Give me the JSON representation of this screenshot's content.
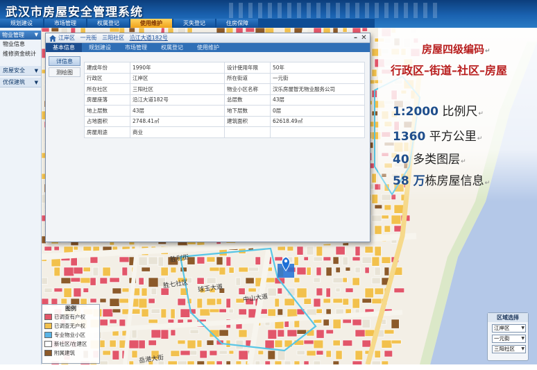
{
  "app": {
    "title": "武汉市房屋安全管理系统"
  },
  "top_nav": {
    "tabs": [
      {
        "label": "规划建设",
        "active": false
      },
      {
        "label": "市场管理",
        "active": false
      },
      {
        "label": "权属登记",
        "active": false
      },
      {
        "label": "使用维护",
        "active": true
      },
      {
        "label": "灭失登记",
        "active": false
      },
      {
        "label": "住房保障",
        "active": false
      }
    ]
  },
  "sidebar": {
    "group1": {
      "label": "物业管理"
    },
    "items": [
      "物业信息",
      "维修资金统计"
    ],
    "group2": {
      "label": "房屋安全"
    },
    "group3": {
      "label": "优保建筑"
    }
  },
  "popup": {
    "breadcrumb": [
      "江岸区",
      "一元街",
      "三阳社区",
      "沿江大道182号"
    ],
    "tabs": [
      "基本信息",
      "规划建设",
      "市场管理",
      "权属登记",
      "使用维护"
    ],
    "active_tab": 0,
    "subnav": [
      "详信息",
      "测绘图"
    ],
    "table": [
      {
        "l1": "建成年份",
        "v1": "1990年",
        "l2": "设计使用年限",
        "v2": "50年"
      },
      {
        "l1": "行政区",
        "v1": "江岸区",
        "l2": "所在街道",
        "v2": "一元街"
      },
      {
        "l1": "所在社区",
        "v1": "三阳社区",
        "l2": "物业小区名称",
        "v2": "汉乐房屋智无物业服务公司"
      },
      {
        "l1": "房屋座落",
        "v1": "沿江大道182号",
        "l2": "总层数",
        "v2": "43层"
      },
      {
        "l1": "地上层数",
        "v1": "43层",
        "l2": "地下层数",
        "v2": "0层"
      },
      {
        "l1": "占地面积",
        "v1": "2748.41㎡",
        "l2": "建筑面积",
        "v2": "62618.49㎡"
      },
      {
        "l1": "房屋用途",
        "v1": "商业",
        "l2": "",
        "v2": ""
      }
    ]
  },
  "map": {
    "labels": {
      "street1": "胜利街",
      "community": "胜七社区",
      "road1": "岳港大街",
      "area1": "球玉大道",
      "area2": "中山大道"
    },
    "colors": {
      "building_red": "#e2566a",
      "building_yellow": "#f2c14d",
      "building_brown": "#8c5a2a",
      "road": "#f7f5ee",
      "river": "#b4c8e8",
      "marker": "#1d6fd6"
    }
  },
  "legend": {
    "title": "图例",
    "items": [
      {
        "label": "已调查有户权",
        "color": "#e2566a"
      },
      {
        "label": "已调查无户权",
        "color": "#f2c14d"
      },
      {
        "label": "专业物业小区",
        "color": "#5ab4e6"
      },
      {
        "label": "新社区/在建区",
        "color": "#ffffff"
      },
      {
        "label": "附属建筑",
        "color": "#8c5a2a"
      }
    ]
  },
  "region": {
    "title": "区域选择",
    "district": "江岸区",
    "street": "一元街",
    "community": "三阳社区"
  },
  "info": {
    "headline1": "房屋四级编码",
    "headline2": "行政区–街道–社区–房屋",
    "stats": [
      {
        "value": "1:2000",
        "text": "比例尺"
      },
      {
        "value": "1360",
        "text": "平方公里"
      },
      {
        "value": "40",
        "text": "多类图层"
      },
      {
        "value": "58 万",
        "text": "栋房屋信息"
      }
    ],
    "para_mark": "↵"
  }
}
